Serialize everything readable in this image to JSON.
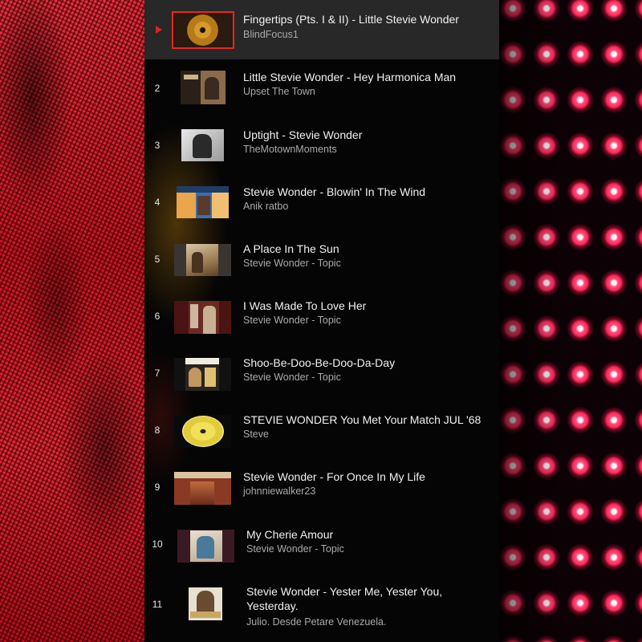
{
  "playlist": {
    "items": [
      {
        "index": "",
        "title": "Fingertips (Pts. I & II) - Little Stevie Wonder",
        "channel": "BlindFocus1"
      },
      {
        "index": "2",
        "title": "Little Stevie Wonder - Hey Harmonica Man",
        "channel": "Upset The Town"
      },
      {
        "index": "3",
        "title": "Uptight - Stevie Wonder",
        "channel": "TheMotownMoments"
      },
      {
        "index": "4",
        "title": "Stevie Wonder - Blowin' In The Wind",
        "channel": "Anik ratbo"
      },
      {
        "index": "5",
        "title": "A Place In The Sun",
        "channel": "Stevie Wonder - Topic"
      },
      {
        "index": "6",
        "title": "I Was Made To Love Her",
        "channel": "Stevie Wonder - Topic"
      },
      {
        "index": "7",
        "title": "Shoo-Be-Doo-Be-Doo-Da-Day",
        "channel": "Stevie Wonder - Topic"
      },
      {
        "index": "8",
        "title": "STEVIE WONDER You Met Your Match JUL '68",
        "channel": "Steve"
      },
      {
        "index": "9",
        "title": "Stevie Wonder - For Once In My Life",
        "channel": "johnniewalker23"
      },
      {
        "index": "10",
        "title": "My Cherie Amour",
        "channel": "Stevie Wonder - Topic"
      },
      {
        "index": "11",
        "title": "Stevie Wonder - Yester Me, Yester You, Yesterday.",
        "channel": "Julio. Desde Petare Venezuela."
      }
    ]
  },
  "colors": {
    "now_playing_accent": "#e0211f",
    "selected_outline": "#e6281f",
    "title_text": "#f1f1f1",
    "channel_text": "#aaaaaa"
  },
  "icons": {
    "now_playing": "play-triangle-icon"
  }
}
